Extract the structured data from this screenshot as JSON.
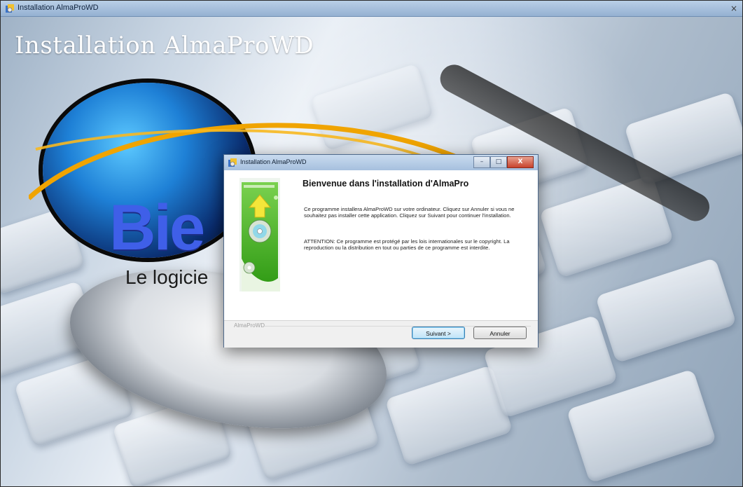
{
  "outer_window": {
    "title": "Installation AlmaProWD",
    "close_glyph": "×"
  },
  "background": {
    "title": "Installation AlmaProWD",
    "logo_text": "Bie",
    "logo_tagline": "Le logicie"
  },
  "dialog": {
    "title": "Installation AlmaProWD",
    "buttons": {
      "minimize": "–",
      "maximize": "□",
      "close": "X"
    },
    "heading": "Bienvenue dans l'installation d'AlmaPro",
    "paragraph1": "Ce programme installera AlmaProWD sur votre ordinateur. Cliquez sur Annuler si vous ne souhaitez pas installer cette application. Cliquez sur Suivant pour continuer l'installation.",
    "paragraph2": "ATTENTION: Ce programme est protégé par les lois internationales sur le copyright. La reproduction ou la distribution en tout ou parties de ce programme est interdite.",
    "footer_brand": "AlmaProWD",
    "next_label": "Suivant >",
    "cancel_label": "Annuler"
  },
  "colors": {
    "accent_blue": "#3f5fe8",
    "swoosh_orange": "#f0a400",
    "graphic_green": "#3fb31f"
  },
  "icons": [
    "installer-icon",
    "minimize-icon",
    "maximize-icon",
    "close-icon",
    "cd-arrow-graphic"
  ]
}
